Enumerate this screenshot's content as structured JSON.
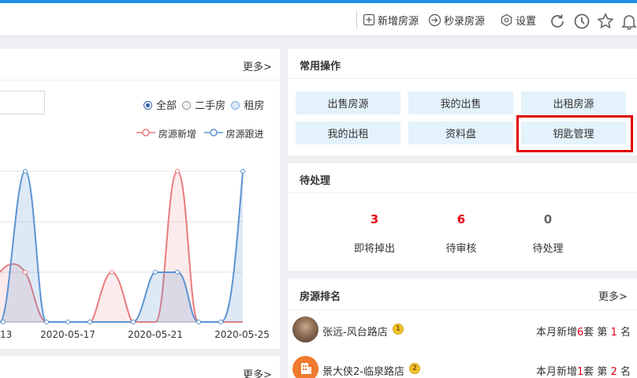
{
  "toolbar": {
    "add_listing": "新增房源",
    "quick_record": "秒录房源",
    "settings": "设置"
  },
  "left_panel": {
    "more": "更多>",
    "radios": [
      "全部",
      "二手房",
      "租房"
    ],
    "selected_radio": "全部",
    "legend": [
      "房源新增",
      "房源跟进"
    ],
    "bottom_more": "更多>"
  },
  "chart_data": {
    "type": "area",
    "x_tick_labels": [
      "13",
      "2020-05-17",
      "2020-05-21",
      "2020-05-25"
    ],
    "series": [
      {
        "name": "房源新增",
        "color": "#e87c7f"
      },
      {
        "name": "房源跟进",
        "color": "#5c93d1"
      }
    ]
  },
  "common_ops": {
    "title": "常用操作",
    "buttons": [
      "出售房源",
      "我的出售",
      "出租房源",
      "我的出租",
      "资料盘",
      "钥匙管理"
    ],
    "highlighted": "钥匙管理"
  },
  "pending": {
    "title": "待处理",
    "items": [
      {
        "count": "3",
        "label": "即将掉出",
        "color": "#e60012"
      },
      {
        "count": "6",
        "label": "待审核",
        "color": "#e60012"
      },
      {
        "count": "0",
        "label": "待处理",
        "color": "#666666"
      }
    ]
  },
  "ranking": {
    "title": "房源排名",
    "more": "更多>",
    "rows": [
      {
        "name": "张远-风台路店",
        "medal": "1",
        "prefix": "本月新增",
        "count": "6",
        "unit": "套",
        "rank_prefix": "第",
        "rank": "1",
        "rank_suffix": "名"
      },
      {
        "name": "景大侠2-临泉路店",
        "medal": "2",
        "prefix": "本月新增",
        "count": "1",
        "unit": "套",
        "rank_prefix": "第",
        "rank": "2",
        "rank_suffix": "名"
      }
    ]
  }
}
